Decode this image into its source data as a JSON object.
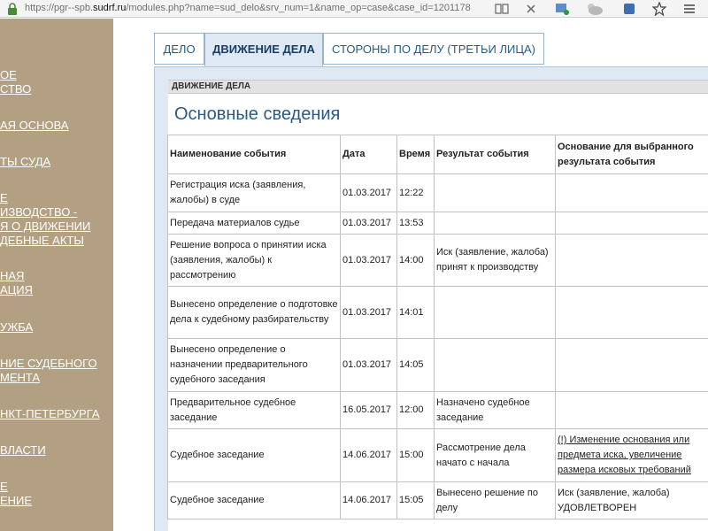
{
  "browser": {
    "url_prefix": "https://pgr--spb.",
    "url_host": "sudrf.ru",
    "url_suffix": "/modules.php?name=sud_delo&srv_num=1&name_op=case&case_id=1201178"
  },
  "sidebar": {
    "items": [
      [
        "ОЕ",
        "СТВО"
      ],
      [
        "АЯ ОСНОВА"
      ],
      [
        "ТЫ СУДА"
      ],
      [
        "Е",
        "ИЗВОДСТВО -",
        "Я О ДВИЖЕНИИ",
        "ДЕБНЫЕ АКТЫ"
      ],
      [
        "НАЯ",
        "АЦИЯ"
      ],
      [
        "УЖБА"
      ],
      [
        "НИЕ СУДЕБНОГО",
        "МЕНТА"
      ],
      [
        "НКТ-ПЕТЕРБУРГА"
      ],
      [
        "ВЛАСТИ"
      ],
      [
        "Е",
        "ЕНИЕ"
      ]
    ]
  },
  "tabs": [
    {
      "label": "ДЕЛО"
    },
    {
      "label": "ДВИЖЕНИЕ ДЕЛА"
    },
    {
      "label": "СТОРОНЫ ПО ДЕЛУ (ТРЕТЬИ ЛИЦА)"
    }
  ],
  "section": {
    "bar_label": "ДВИЖЕНИЕ ДЕЛА",
    "title": "Основные сведения"
  },
  "table": {
    "headers": [
      "Наименование события",
      "Дата",
      "Время",
      "Результат события",
      "Основание для выбранного результата события"
    ],
    "rows": [
      [
        "Регистрация иска (заявления, жалобы) в суде",
        "01.03.2017",
        "12:22",
        "",
        ""
      ],
      [
        "Передача материалов судье",
        "01.03.2017",
        "13:53",
        "",
        ""
      ],
      [
        "Решение вопроса о принятии иска (заявления, жалобы) к рассмотрению",
        "01.03.2017",
        "14:00",
        "Иск (заявление, жалоба) принят к производству",
        ""
      ],
      [
        "Вынесено определение о подготовке дела к судебному разбирательству",
        "01.03.2017",
        "14:01",
        "",
        ""
      ],
      [
        "Вынесено определение о назначении предварительного судебного заседания",
        "01.03.2017",
        "14:05",
        "",
        ""
      ],
      [
        "Предварительное судебное заседание",
        "16.05.2017",
        "12:00",
        "Назначено судебное заседание",
        ""
      ],
      [
        "Судебное заседание",
        "14.06.2017",
        "15:00",
        "Рассмотрение дела начато с начала",
        "(!) Изменение основания или предмета иска, увеличение размера исковых требований"
      ],
      [
        "Судебное заседание",
        "14.06.2017",
        "15:05",
        "Вынесено решение по делу",
        "Иск (заявление, жалоба) УДОВЛЕТВОРЕН"
      ]
    ]
  }
}
